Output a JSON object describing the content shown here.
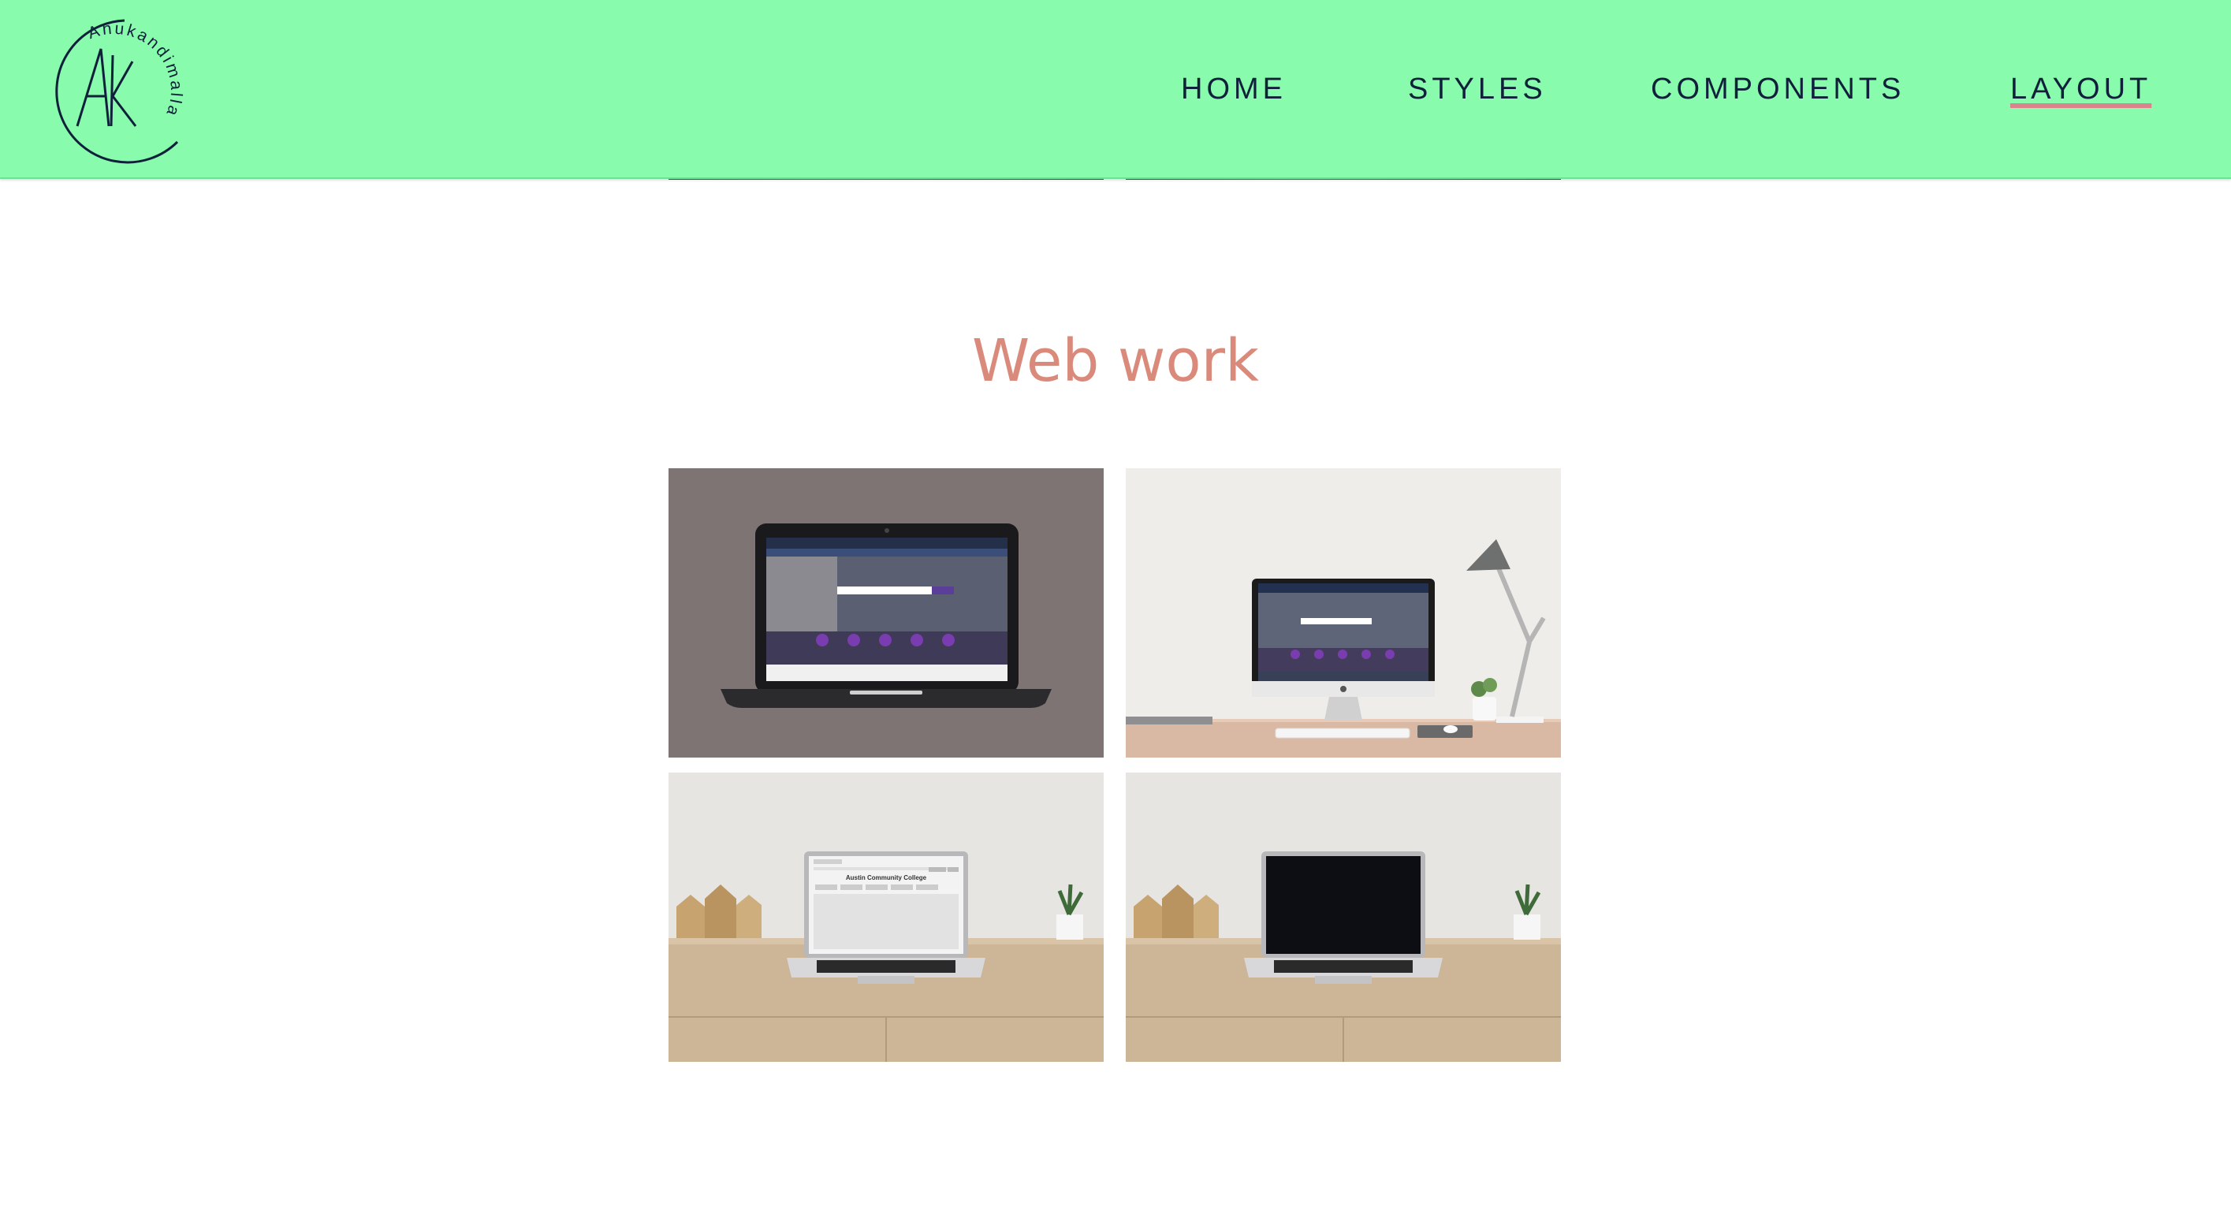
{
  "brand": {
    "monogram": "AK",
    "ring_text": "Anukandimalla",
    "accent": "#88fbad",
    "ink": "#10203a"
  },
  "nav": {
    "items": [
      {
        "label": "HOME"
      },
      {
        "label": "STYLES"
      },
      {
        "label": "COMPONENTS"
      },
      {
        "label": "LAYOUT",
        "active": true
      }
    ]
  },
  "section": {
    "title": "Web work",
    "title_color": "#da8a7b"
  },
  "gallery": {
    "items": [
      {
        "icon": "laptop-mockup-image",
        "screen": "website-homepage"
      },
      {
        "icon": "desktop-mockup-image",
        "screen": "website-homepage"
      },
      {
        "icon": "macbook-mockup-image",
        "screen": "Austin Community College"
      },
      {
        "icon": "macbook-blank-mockup-image",
        "screen": "blank"
      }
    ]
  }
}
